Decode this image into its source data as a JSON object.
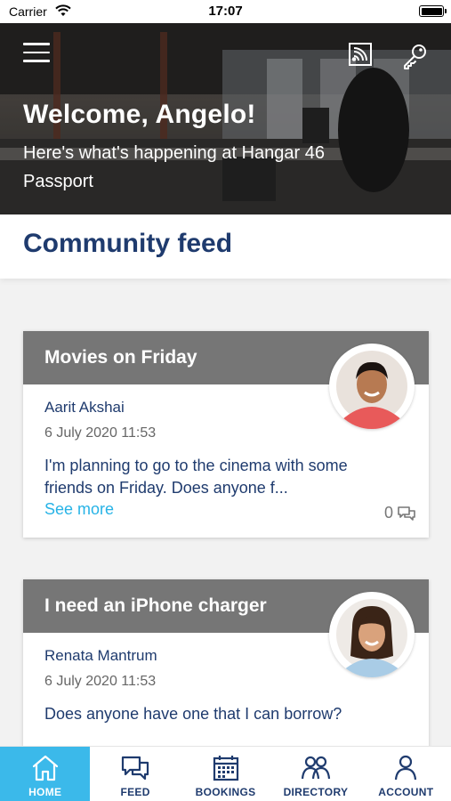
{
  "status_bar": {
    "carrier": "Carrier",
    "time": "17:07"
  },
  "hero": {
    "welcome": "Welcome, Angelo!",
    "subtitle": "Here's what's happening at Hangar 46 Passport"
  },
  "feed": {
    "title": "Community feed",
    "posts": [
      {
        "title": "Movies on Friday",
        "author": "Aarit Akshai",
        "date": "6 July 2020 11:53",
        "body": "I'm planning to go to the cinema with some friends on Friday. Does anyone f...",
        "see_more": "See more",
        "comment_count": "0",
        "avatar_icon": "male-avatar-icon"
      },
      {
        "title": "I need an iPhone charger",
        "author": "Renata Mantrum",
        "date": "6 July 2020 11:53",
        "body": "Does anyone have one that I can borrow?",
        "avatar_icon": "female-avatar-icon"
      }
    ]
  },
  "tabbar": {
    "active": "home",
    "tabs": [
      {
        "id": "home",
        "label": "HOME",
        "icon": "home-icon"
      },
      {
        "id": "feed",
        "label": "FEED",
        "icon": "chat-icon"
      },
      {
        "id": "bookings",
        "label": "BOOKINGS",
        "icon": "calendar-icon"
      },
      {
        "id": "directory",
        "label": "DIRECTORY",
        "icon": "people-icon"
      },
      {
        "id": "account",
        "label": "ACCOUNT",
        "icon": "person-icon"
      }
    ]
  },
  "colors": {
    "navy": "#1f3b6e",
    "accent": "#3bb9ea",
    "link": "#27b3e6",
    "card_header": "#767676"
  }
}
